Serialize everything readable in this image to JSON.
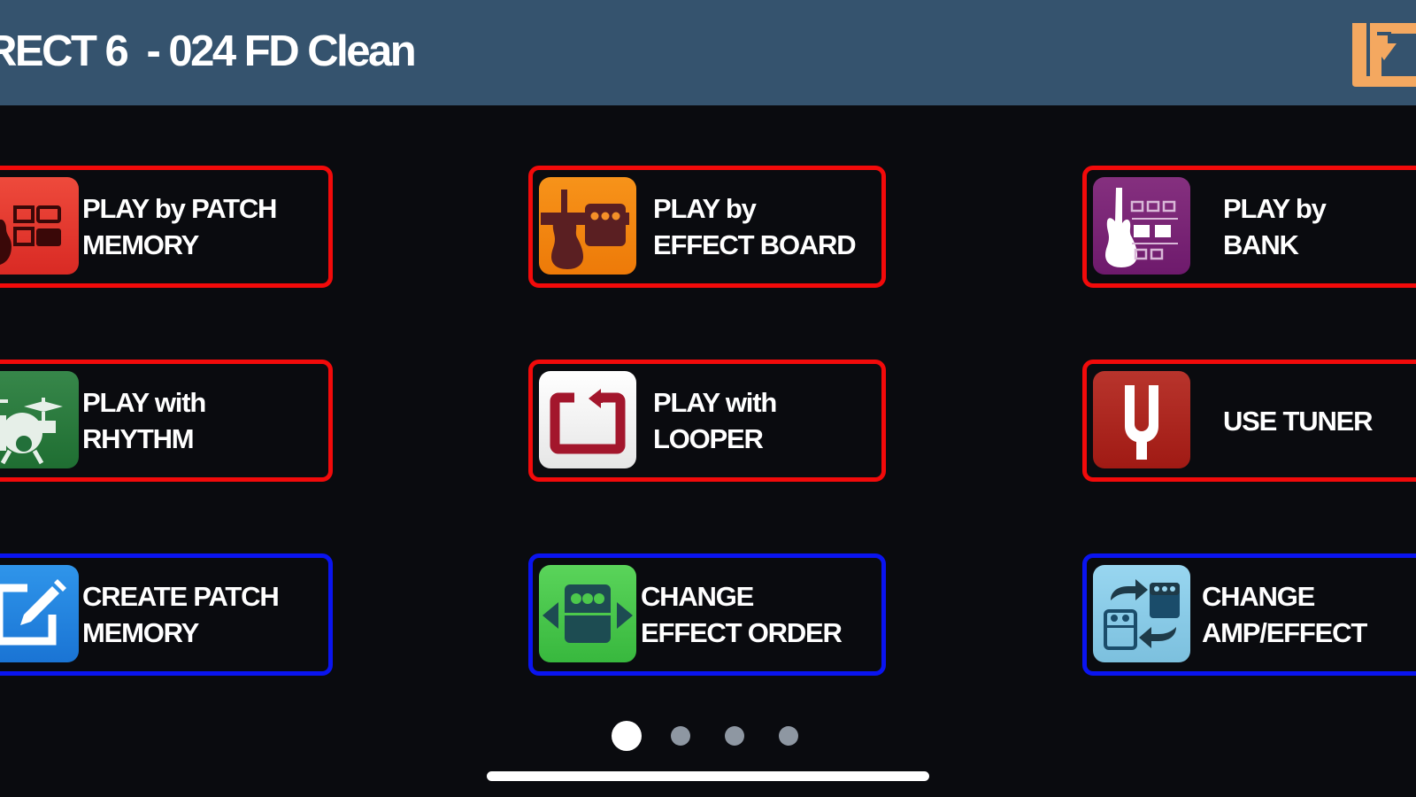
{
  "header": {
    "title": "RECT 6  - 024 FD Clean",
    "exit_icon": "exit-import-icon",
    "exit_icon_color": "#f4a860"
  },
  "buttons": [
    {
      "id": "play-by-patch-memory",
      "line1": "PLAY by PATCH",
      "line2": "MEMORY",
      "icon": "guitar-patch-icon",
      "icon_color": "#e8312a",
      "frame_color": "#f20a0a"
    },
    {
      "id": "play-by-effect-board",
      "line1": "PLAY by",
      "line2": "EFFECT BOARD",
      "icon": "guitar-pedal-icon",
      "icon_color": "#f08a10",
      "frame_color": "#f20a0a"
    },
    {
      "id": "play-by-bank",
      "line1": "PLAY by",
      "line2": "BANK",
      "icon": "guitar-bank-icon",
      "icon_color": "#7a2a7c",
      "frame_color": "#f20a0a"
    },
    {
      "id": "play-with-rhythm",
      "line1": "PLAY with",
      "line2": "RHYTHM",
      "icon": "drum-kit-icon",
      "icon_color": "#2a8040",
      "frame_color": "#f20a0a"
    },
    {
      "id": "play-with-looper",
      "line1": "PLAY with",
      "line2": "LOOPER",
      "icon": "loop-icon",
      "icon_color": "#f2f2f2",
      "frame_color": "#f20a0a"
    },
    {
      "id": "use-tuner",
      "line1": "USE TUNER",
      "line2": "",
      "icon": "tuning-fork-icon",
      "icon_color": "#b02820",
      "frame_color": "#f20a0a"
    },
    {
      "id": "create-patch-memory",
      "line1": "CREATE PATCH",
      "line2": "MEMORY",
      "icon": "edit-pencil-icon",
      "icon_color": "#2a8ae0",
      "frame_color": "#0a14f0"
    },
    {
      "id": "change-effect-order",
      "line1": "CHANGE",
      "line2": "EFFECT ORDER",
      "icon": "effect-order-icon",
      "icon_color": "#4cc94c",
      "frame_color": "#0a14f0"
    },
    {
      "id": "change-amp-effect",
      "line1": "CHANGE",
      "line2": "AMP/EFFECT",
      "icon": "swap-pedals-icon",
      "icon_color": "#8ccde8",
      "frame_color": "#0a14f0"
    }
  ],
  "pagination": {
    "current_page": 1,
    "total_pages": 4,
    "active_color": "#ffffff",
    "inactive_color": "#8e97a2"
  }
}
